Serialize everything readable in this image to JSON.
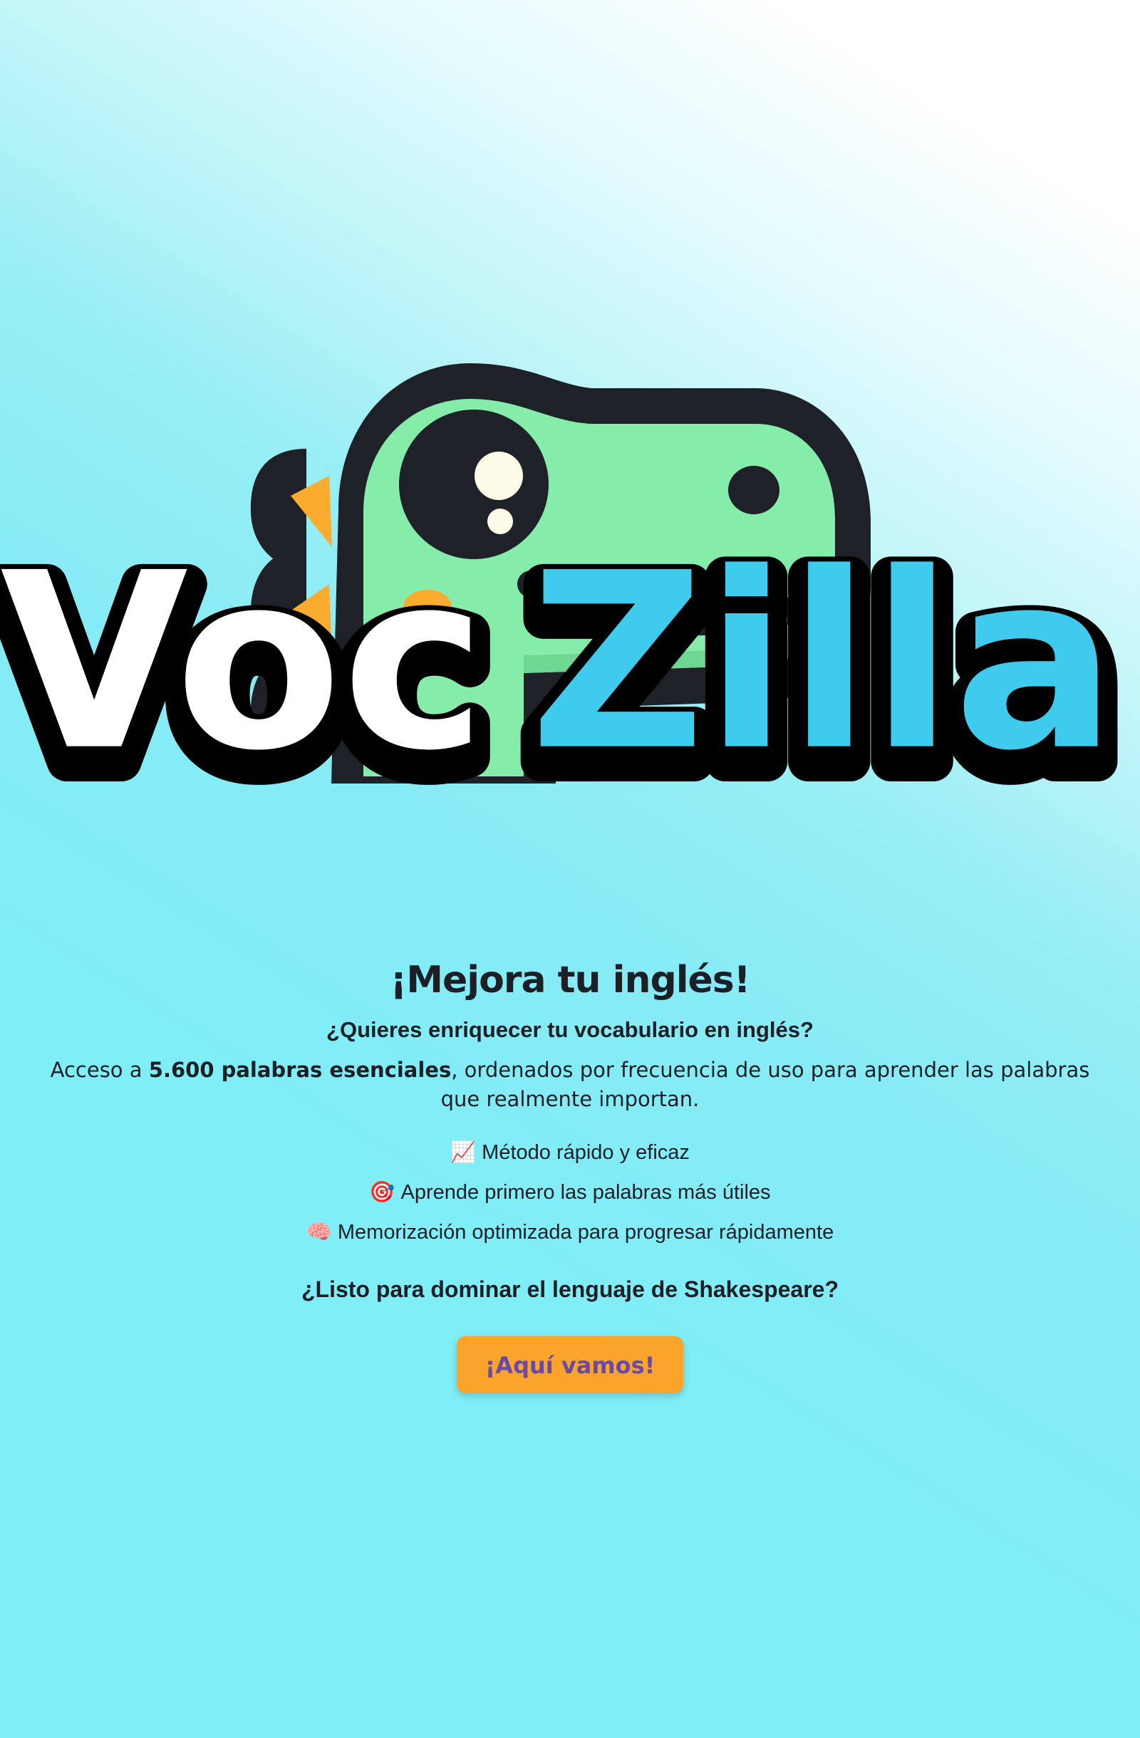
{
  "logo": {
    "part1": "Voc",
    "part2": "Zilla"
  },
  "hero": {
    "headline": "¡Mejora tu inglés!",
    "question": "¿Quieres enriquecer tu vocabulario en inglés?",
    "access_prefix": "Acceso a ",
    "access_bold": "5.600 palabras esenciales",
    "access_suffix": ", ordenados por frecuencia de uso para aprender las palabras que realmente importan."
  },
  "features": [
    {
      "icon": "chart-increasing-icon",
      "glyph": "📈",
      "text": "Método rápido y eficaz"
    },
    {
      "icon": "target-icon",
      "glyph": "🎯",
      "text": "Aprende primero las palabras más útiles"
    },
    {
      "icon": "brain-icon",
      "glyph": "🧠",
      "text": "Memorización optimizada para progresar rápidamente"
    }
  ],
  "ready": "¿Listo para dominar el lenguaje de Shakespeare?",
  "cta": {
    "label": "¡Aquí vamos!"
  },
  "colors": {
    "background": "#7feef6",
    "dino_green": "#86ecaa",
    "dino_outline": "#1e2128",
    "spikes": "#fbab2e",
    "zilla_blue": "#3fcbee",
    "button": "#fba42c",
    "button_text": "#6a4aa6"
  }
}
